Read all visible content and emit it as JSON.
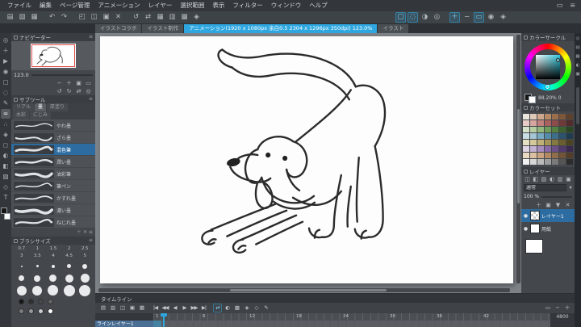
{
  "accent": "#2ea7e0",
  "ui": {
    "menu_glyph": "≡",
    "close_glyph": "✕",
    "caret_glyph": "▼",
    "eye_glyph": "●"
  },
  "menubar": {
    "items": [
      "ファイル",
      "編集",
      "ページ管理",
      "アニメーション",
      "レイヤー",
      "選択範囲",
      "表示",
      "フィルター",
      "ウィンドウ",
      "ヘルプ"
    ],
    "right_icons": [
      {
        "name": "workspace-icon",
        "glyph": "▭"
      },
      {
        "name": "app-menu-icon",
        "glyph": "≡"
      }
    ]
  },
  "toolbar": {
    "groups": [
      {
        "icons": [
          {
            "name": "new-file-icon",
            "glyph": "▤"
          },
          {
            "name": "open-file-icon",
            "glyph": "▧"
          },
          {
            "name": "save-icon",
            "glyph": "▦"
          }
        ]
      },
      {
        "icons": [
          {
            "name": "undo-icon",
            "glyph": "↶"
          },
          {
            "name": "redo-icon",
            "glyph": "↷"
          }
        ]
      },
      {
        "icons": [
          {
            "name": "cut-icon",
            "glyph": "◰"
          },
          {
            "name": "copy-icon",
            "glyph": "◫"
          },
          {
            "name": "paste-icon",
            "glyph": "▣"
          },
          {
            "name": "delete-icon",
            "glyph": "✕"
          }
        ]
      },
      {
        "icons": [
          {
            "name": "rotate-view-icon",
            "glyph": "↺"
          },
          {
            "name": "flip-view-icon",
            "glyph": "⇄"
          },
          {
            "name": "grid-icon",
            "glyph": "▦"
          },
          {
            "name": "ruler-icon",
            "glyph": "▥"
          },
          {
            "name": "snap-ruler-icon",
            "glyph": "▩"
          },
          {
            "name": "snap-special-icon",
            "glyph": "◈"
          }
        ]
      },
      {
        "icons": [
          {
            "name": "select-rectangle-icon",
            "glyph": "▢",
            "active": true
          },
          {
            "name": "deselect-icon",
            "glyph": "◌",
            "active": true
          },
          {
            "name": "invert-selection-icon",
            "glyph": "◑"
          },
          {
            "name": "selection-border-icon",
            "glyph": "◎"
          }
        ]
      },
      {
        "icons": [
          {
            "name": "zoom-in-icon",
            "glyph": "＋",
            "active": true
          },
          {
            "name": "zoom-out-icon",
            "glyph": "−"
          },
          {
            "name": "fit-to-screen-icon",
            "glyph": "▭",
            "active": true
          },
          {
            "name": "actual-pixels-icon",
            "glyph": "◉"
          },
          {
            "name": "toolbar-settings-icon",
            "glyph": "◈"
          }
        ]
      }
    ]
  },
  "tabbar": {
    "tabs": [
      {
        "label": "イラストコラボ"
      },
      {
        "label": "イラスト制作"
      },
      {
        "label": "アニメーション(1920 x 1080px 余白0.5 2304 x 1296px 350dpi) 123.0%",
        "active": true
      },
      {
        "label": "イラスト"
      }
    ]
  },
  "toolstrip": {
    "tools": [
      {
        "name": "zoom-tool-icon",
        "glyph": "◎"
      },
      {
        "name": "move-tool-icon",
        "glyph": "＋"
      },
      {
        "name": "operation-tool-icon",
        "glyph": "▶"
      },
      {
        "name": "eyedropper-tool-icon",
        "glyph": "◉"
      },
      {
        "name": "selection-tool-icon",
        "glyph": "▢"
      },
      {
        "name": "auto-select-tool-icon",
        "glyph": "◌"
      },
      {
        "name": "pen-tool-icon",
        "glyph": "✎"
      },
      {
        "name": "brush-tool-icon",
        "glyph": "≈"
      },
      {
        "name": "airbrush-tool-icon",
        "glyph": "∴"
      },
      {
        "name": "decoration-tool-icon",
        "glyph": "◈"
      },
      {
        "name": "eraser-tool-icon",
        "glyph": "◻"
      },
      {
        "name": "blend-tool-icon",
        "glyph": "◐"
      },
      {
        "name": "fill-tool-icon",
        "glyph": "◧"
      },
      {
        "name": "gradient-tool-icon",
        "glyph": "▨"
      },
      {
        "name": "figure-tool-icon",
        "glyph": "◇"
      },
      {
        "name": "text-tool-icon",
        "glyph": "T"
      }
    ]
  },
  "navigator": {
    "title": "ナビゲーター",
    "zoom_value": "123.0",
    "row1": [
      {
        "name": "zoom-out-nav-icon",
        "glyph": "−"
      },
      {
        "name": "zoom-in-nav-icon",
        "glyph": "＋"
      },
      {
        "name": "zoom-100-icon",
        "glyph": "▣"
      },
      {
        "name": "fit-window-icon",
        "glyph": "▭"
      }
    ],
    "row2": [
      {
        "name": "rotate-left-icon",
        "glyph": "↺"
      },
      {
        "name": "rotate-right-icon",
        "glyph": "↻"
      },
      {
        "name": "flip-horizontal-icon",
        "glyph": "⇄"
      },
      {
        "name": "reset-view-icon",
        "glyph": "◎"
      }
    ]
  },
  "subtool": {
    "title": "サブツール",
    "tab_rows": [
      [
        {
          "label": "リアル"
        },
        {
          "label": "墨",
          "active": true
        },
        {
          "label": "厚塗り"
        }
      ],
      [
        {
          "label": "水彩"
        },
        {
          "label": "にじみ"
        }
      ]
    ],
    "brushes": [
      {
        "label": "やわ墨"
      },
      {
        "label": "ざら墨"
      },
      {
        "label": "混色筆",
        "active": true
      },
      {
        "label": "潤い墨"
      },
      {
        "label": "油彩筆"
      },
      {
        "label": "筆ペン"
      },
      {
        "label": "かすれ墨"
      },
      {
        "label": "濃い墨"
      },
      {
        "label": "ねじれ墨"
      }
    ],
    "footer_icons": [
      {
        "name": "add-subtool-icon",
        "glyph": "＋"
      },
      {
        "name": "delete-subtool-icon",
        "glyph": "✕"
      },
      {
        "name": "subtool-menu-icon",
        "glyph": "≡"
      }
    ]
  },
  "brushsize": {
    "title": "ブラシサイズ",
    "values": [
      "0.7",
      "1",
      "1.5",
      "2",
      "2.5",
      "3",
      "3.5",
      "4",
      "4.5",
      "5"
    ],
    "dot_rows": [
      [
        2,
        3,
        4,
        5,
        6
      ],
      [
        7,
        8,
        9,
        10,
        11
      ],
      [
        12,
        12,
        13,
        14,
        14
      ]
    ]
  },
  "quick_colors": [
    "#161616",
    "#303030",
    "#4a4a4a",
    "#646464",
    "#7e7e7e",
    "#989898",
    "#cccccc",
    "#ffffff"
  ],
  "colorpanel": {
    "title": "カラーサークル",
    "readout": "88.20% 0",
    "current": "#2ec9de"
  },
  "colorset": {
    "title": "カラーセット",
    "swatches": [
      "#ece7dd",
      "#ddc9b6",
      "#cda88c",
      "#b78a66",
      "#9c6f4c",
      "#7d573a",
      "#5e412c",
      "#e8cbc6",
      "#d6a5a0",
      "#c1807c",
      "#aa605e",
      "#8d4b4a",
      "#6f3a39",
      "#522b2a",
      "#d7e1ca",
      "#b6cda1",
      "#92b67b",
      "#709c5a",
      "#548042",
      "#3d622f",
      "#2b4721",
      "#cadde6",
      "#a3c5d6",
      "#7aa9c2",
      "#568ba8",
      "#3f6e8a",
      "#2d526c",
      "#1f3b4f",
      "#e7e1c4",
      "#d5c99c",
      "#c0af76",
      "#a59457",
      "#877a40",
      "#6a5e2f",
      "#4c4321",
      "#dfd5e4",
      "#c3b1d2",
      "#a68bbd",
      "#8869a5",
      "#6d5089",
      "#523a6c",
      "#3b2950",
      "#e9d8c2",
      "#dbc0a2",
      "#caa481",
      "#b18964",
      "#906d4b",
      "#715439",
      "#533d29",
      "#f1f1f1",
      "#d7d7d7",
      "#bbbbbb",
      "#9d9d9d",
      "#7b7b7b",
      "#555555",
      "#2d2d2d"
    ]
  },
  "layers": {
    "title": "レイヤー",
    "blend": "通常",
    "opacity_label": "100 %",
    "header_icons": [
      {
        "name": "blend-mode-icon",
        "glyph": "◫"
      },
      {
        "name": "lock-layer-icon",
        "glyph": "◧"
      },
      {
        "name": "lock-transparent-icon",
        "glyph": "▨"
      },
      {
        "name": "layer-mask-icon",
        "glyph": "◐"
      },
      {
        "name": "ruler-layer-icon",
        "glyph": "▥"
      },
      {
        "name": "layer-folder-icon",
        "glyph": "▣"
      }
    ],
    "toolbar_icons": [
      {
        "name": "new-layer-icon",
        "glyph": "＋"
      },
      {
        "name": "new-folder-icon",
        "glyph": "▣"
      },
      {
        "name": "merge-down-icon",
        "glyph": "▼"
      },
      {
        "name": "delete-layer-icon",
        "glyph": "✕"
      }
    ],
    "items": [
      {
        "name": "レイヤー1",
        "active": true,
        "thumb": "checker"
      },
      {
        "name": "用紙",
        "active": false,
        "thumb": "white"
      }
    ]
  },
  "timeline": {
    "title": "タイムライン",
    "left_icons": [
      {
        "name": "timeline-menu-icon",
        "glyph": "▤"
      },
      {
        "name": "new-timeline-icon",
        "glyph": "▥"
      },
      {
        "name": "new-cel-icon",
        "glyph": "◫"
      },
      {
        "name": "cel-folder-icon",
        "glyph": "▣"
      },
      {
        "name": "light-table-icon",
        "glyph": "▦"
      }
    ],
    "transport": [
      {
        "name": "go-to-start-button",
        "glyph": "|◀"
      },
      {
        "name": "prev-frame-button",
        "glyph": "◀◀"
      },
      {
        "name": "play-backward-button",
        "glyph": "◀"
      },
      {
        "name": "play-button",
        "glyph": "▶"
      },
      {
        "name": "next-frame-button",
        "glyph": "▶▶"
      },
      {
        "name": "go-to-end-button",
        "glyph": "▶|"
      }
    ],
    "mid_icons": [
      {
        "name": "loop-playback-icon",
        "glyph": "⇄",
        "active": true
      },
      {
        "name": "onion-skin-icon",
        "glyph": "◐"
      },
      {
        "name": "cel-display-icon",
        "glyph": "▩"
      },
      {
        "name": "sound-icon",
        "glyph": "◈"
      },
      {
        "name": "keyframe-icon",
        "glyph": "◇"
      },
      {
        "name": "edit-timeline-icon",
        "glyph": "✎"
      }
    ],
    "right_icons": [
      {
        "name": "frame-rate-icon",
        "glyph": "▭"
      },
      {
        "name": "timeline-zoom-out-icon",
        "glyph": "−"
      },
      {
        "name": "timeline-zoom-in-icon",
        "glyph": "＋"
      }
    ],
    "ruler_numbers": [
      "1",
      "6",
      "12",
      "18",
      "24",
      "30",
      "36",
      "42"
    ],
    "end_frame": "4800",
    "track_label": "ラインレイヤー1"
  },
  "edge_tabs": [
    {
      "name": "color-wheel-tab-icon",
      "glyph": "◎"
    },
    {
      "name": "color-slider-tab-icon",
      "glyph": "▤"
    },
    {
      "name": "color-set-tab-icon",
      "glyph": "▦"
    },
    {
      "name": "color-mixing-tab-icon",
      "glyph": "◐"
    },
    {
      "name": "history-tab-icon",
      "glyph": "▣"
    }
  ]
}
